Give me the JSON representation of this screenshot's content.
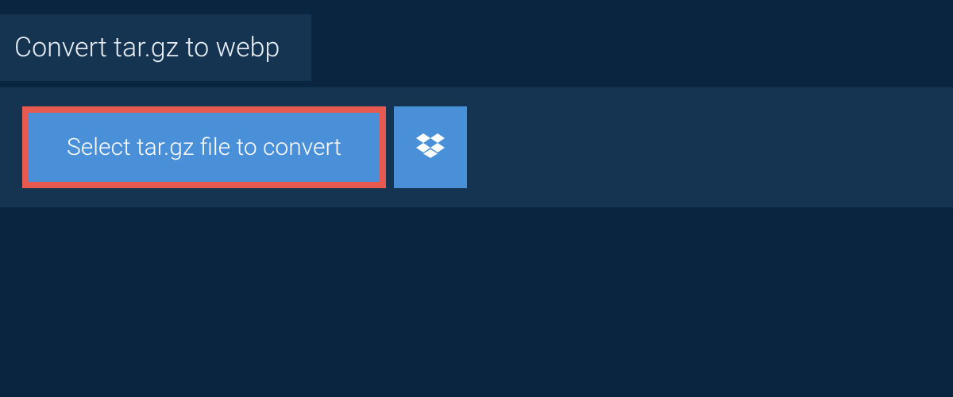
{
  "header": {
    "title": "Convert tar.gz to webp"
  },
  "upload": {
    "select_label": "Select tar.gz file to convert",
    "dropbox_icon_name": "dropbox-icon"
  }
}
